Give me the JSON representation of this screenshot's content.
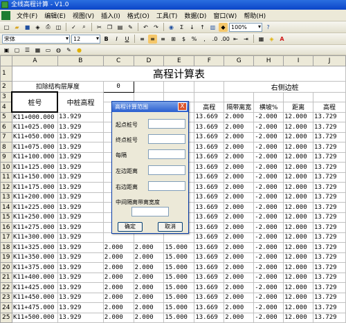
{
  "window": {
    "title": "全线高程计算 - V1.0"
  },
  "menu": [
    "文件(F)",
    "编辑(E)",
    "视图(V)",
    "插入(I)",
    "格式(O)",
    "工具(T)",
    "数据(D)",
    "窗口(W)",
    "帮助(H)"
  ],
  "toolbar": {
    "zoom": "100%",
    "font": "宋体",
    "size": "12"
  },
  "formula": {
    "cell_ref": "A3",
    "fx": "fx",
    "content": "桩号"
  },
  "columns": [
    "A",
    "B",
    "C",
    "D",
    "E",
    "F",
    "G",
    "H",
    "I",
    "J"
  ],
  "sheet": {
    "title": "高程计算表",
    "r2_label": "扣除结构层厚度",
    "r2_value": "0",
    "right_group": "右侧边桩",
    "h_a": "桩号",
    "h_b": "中桩高程",
    "h_c": "隔",
    "h_f": "高程",
    "h_g": "隔带离宽",
    "h_h": "横坡%",
    "h_i": "距离",
    "h_j": "高程"
  },
  "rows": [
    {
      "n": "5",
      "a": "K11+000.000",
      "b": "13.929",
      "c": "",
      "d": "",
      "e": "",
      "f": "13.669",
      "g": "2.000",
      "h": "-2.000",
      "i": "12.000",
      "j": "13.729"
    },
    {
      "n": "6",
      "a": "K11+025.000",
      "b": "13.929",
      "c": "",
      "d": "",
      "e": "",
      "f": "13.669",
      "g": "2.000",
      "h": "-2.000",
      "i": "12.000",
      "j": "13.729"
    },
    {
      "n": "7",
      "a": "K11+050.000",
      "b": "13.929",
      "c": "",
      "d": "",
      "e": "",
      "f": "13.669",
      "g": "2.000",
      "h": "-2.000",
      "i": "12.000",
      "j": "13.729"
    },
    {
      "n": "8",
      "a": "K11+075.000",
      "b": "13.929",
      "c": "",
      "d": "",
      "e": "",
      "f": "13.669",
      "g": "2.000",
      "h": "-2.000",
      "i": "12.000",
      "j": "13.729"
    },
    {
      "n": "9",
      "a": "K11+100.000",
      "b": "13.929",
      "c": "",
      "d": "",
      "e": "",
      "f": "13.669",
      "g": "2.000",
      "h": "-2.000",
      "i": "12.000",
      "j": "13.729"
    },
    {
      "n": "10",
      "a": "K11+125.000",
      "b": "13.929",
      "c": "",
      "d": "",
      "e": "",
      "f": "13.669",
      "g": "2.000",
      "h": "-2.000",
      "i": "12.000",
      "j": "13.729"
    },
    {
      "n": "11",
      "a": "K11+150.000",
      "b": "13.929",
      "c": "",
      "d": "",
      "e": "",
      "f": "13.669",
      "g": "2.000",
      "h": "-2.000",
      "i": "12.000",
      "j": "13.729"
    },
    {
      "n": "12",
      "a": "K11+175.000",
      "b": "13.929",
      "c": "",
      "d": "",
      "e": "",
      "f": "13.669",
      "g": "2.000",
      "h": "-2.000",
      "i": "12.000",
      "j": "13.729"
    },
    {
      "n": "13",
      "a": "K11+200.000",
      "b": "13.929",
      "c": "",
      "d": "",
      "e": "",
      "f": "13.669",
      "g": "2.000",
      "h": "-2.000",
      "i": "12.000",
      "j": "13.729"
    },
    {
      "n": "14",
      "a": "K11+225.000",
      "b": "13.929",
      "c": "",
      "d": "",
      "e": "",
      "f": "13.669",
      "g": "2.000",
      "h": "-2.000",
      "i": "12.000",
      "j": "13.729"
    },
    {
      "n": "15",
      "a": "K11+250.000",
      "b": "13.929",
      "c": "",
      "d": "",
      "e": "",
      "f": "13.669",
      "g": "2.000",
      "h": "-2.000",
      "i": "12.000",
      "j": "13.729"
    },
    {
      "n": "16",
      "a": "K11+275.000",
      "b": "13.929",
      "c": "",
      "d": "",
      "e": "",
      "f": "13.669",
      "g": "2.000",
      "h": "-2.000",
      "i": "12.000",
      "j": "13.729"
    },
    {
      "n": "17",
      "a": "K11+300.000",
      "b": "13.929",
      "c": "",
      "d": "",
      "e": "",
      "f": "13.669",
      "g": "2.000",
      "h": "-2.000",
      "i": "12.000",
      "j": "13.729"
    },
    {
      "n": "18",
      "a": "K11+325.000",
      "b": "13.929",
      "c": "2.000",
      "d": "2.000",
      "e": "15.000",
      "f": "13.669",
      "g": "2.000",
      "h": "-2.000",
      "i": "12.000",
      "j": "13.729"
    },
    {
      "n": "19",
      "a": "K11+350.000",
      "b": "13.929",
      "c": "2.000",
      "d": "2.000",
      "e": "15.000",
      "f": "13.669",
      "g": "2.000",
      "h": "-2.000",
      "i": "12.000",
      "j": "13.729"
    },
    {
      "n": "20",
      "a": "K11+375.000",
      "b": "13.929",
      "c": "2.000",
      "d": "2.000",
      "e": "15.000",
      "f": "13.669",
      "g": "2.000",
      "h": "-2.000",
      "i": "12.000",
      "j": "13.729"
    },
    {
      "n": "21",
      "a": "K11+400.000",
      "b": "13.929",
      "c": "2.000",
      "d": "2.000",
      "e": "15.000",
      "f": "13.669",
      "g": "2.000",
      "h": "-2.000",
      "i": "12.000",
      "j": "13.729"
    },
    {
      "n": "22",
      "a": "K11+425.000",
      "b": "13.929",
      "c": "2.000",
      "d": "2.000",
      "e": "15.000",
      "f": "13.669",
      "g": "2.000",
      "h": "-2.000",
      "i": "12.000",
      "j": "13.729"
    },
    {
      "n": "23",
      "a": "K11+450.000",
      "b": "13.929",
      "c": "2.000",
      "d": "2.000",
      "e": "15.000",
      "f": "13.669",
      "g": "2.000",
      "h": "-2.000",
      "i": "12.000",
      "j": "13.729"
    },
    {
      "n": "24",
      "a": "K11+475.000",
      "b": "13.929",
      "c": "2.000",
      "d": "2.000",
      "e": "15.000",
      "f": "13.669",
      "g": "2.000",
      "h": "-2.000",
      "i": "12.000",
      "j": "13.729"
    },
    {
      "n": "25",
      "a": "K11+500.000",
      "b": "13.929",
      "c": "2.000",
      "d": "2.000",
      "e": "15.000",
      "f": "13.669",
      "g": "2.000",
      "h": "-2.000",
      "i": "12.000",
      "j": "13.729"
    }
  ],
  "dialog": {
    "title": "高程计算范围",
    "close": "X",
    "start": "起点桩号",
    "end": "终点桩号",
    "interval": "每隔",
    "left": "左边距离",
    "right": "右边距离",
    "median": "中间隔离带离宽度",
    "ok": "确定",
    "cancel": "取消"
  }
}
